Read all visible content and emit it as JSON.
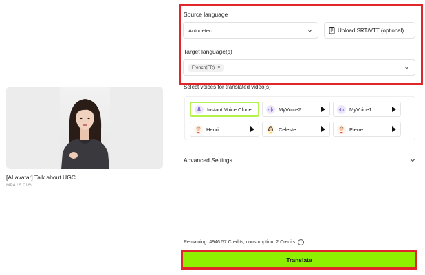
{
  "video": {
    "title": "[AI avatar] Talk about UGC",
    "meta": "MP4 / 5.016s"
  },
  "source_language": {
    "label": "Source language",
    "value": "Autodetect",
    "upload_label": "Upload SRT/VTT (optional)"
  },
  "target_language": {
    "label": "Target language(s)",
    "chips": [
      "French(FR)"
    ]
  },
  "voices": {
    "label": "Select voices for translated video(s)",
    "items": [
      {
        "name": "Instant Voice Clone",
        "selected": true,
        "avatar": "microphone-avatar-icon"
      },
      {
        "name": "MyVoice2",
        "selected": false,
        "avatar": "voice-wave-avatar-icon"
      },
      {
        "name": "MyVoice1",
        "selected": false,
        "avatar": "voice-wave-avatar-icon"
      },
      {
        "name": "Henri",
        "selected": false,
        "avatar": "man-avatar-icon"
      },
      {
        "name": "Celeste",
        "selected": false,
        "avatar": "woman-avatar-icon"
      },
      {
        "name": "Pierre",
        "selected": false,
        "avatar": "man-avatar-icon"
      }
    ]
  },
  "advanced_settings": {
    "label": "Advanced Settings"
  },
  "credits": {
    "text": "Remaining: 4946.57 Credits; consumption: 2 Credits"
  },
  "translate": {
    "label": "Translate"
  },
  "colors": {
    "accent": "#8ef000",
    "highlight_border": "#e0262a",
    "selected_voice_border": "#b5f24d"
  }
}
